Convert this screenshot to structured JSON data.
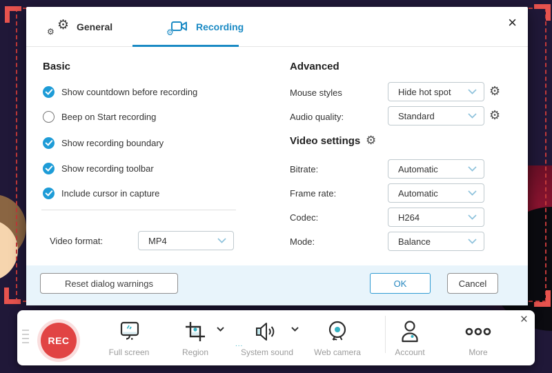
{
  "dialog": {
    "close_glyph": "×",
    "tabs": [
      {
        "label": "General",
        "active": false
      },
      {
        "label": "Recording",
        "active": true
      }
    ],
    "basic": {
      "heading": "Basic",
      "options": [
        {
          "label": "Show countdown before recording",
          "checked": true
        },
        {
          "label": "Beep on Start recording",
          "checked": false
        },
        {
          "label": "Show recording boundary",
          "checked": true
        },
        {
          "label": "Show recording toolbar",
          "checked": true
        },
        {
          "label": "Include cursor in capture",
          "checked": true
        }
      ],
      "video_format": {
        "label": "Video format:",
        "value": "MP4"
      }
    },
    "advanced": {
      "heading": "Advanced",
      "rows": [
        {
          "label": "Mouse styles",
          "value": "Hide hot spot"
        },
        {
          "label": "Audio quality:",
          "value": "Standard"
        }
      ],
      "video_settings_heading": "Video settings",
      "video_rows": [
        {
          "label": "Bitrate:",
          "value": "Automatic"
        },
        {
          "label": "Frame rate:",
          "value": "Automatic"
        },
        {
          "label": "Codec:",
          "value": "H264"
        },
        {
          "label": "Mode:",
          "value": "Balance"
        }
      ]
    },
    "footer": {
      "reset_label": "Reset dialog warnings",
      "ok_label": "OK",
      "cancel_label": "Cancel"
    }
  },
  "toolbar": {
    "rec_label": "REC",
    "close_glyph": "×",
    "dots_glyph": "...",
    "items": [
      {
        "label": "Full screen"
      },
      {
        "label": "Region"
      },
      {
        "label": "System sound"
      },
      {
        "label": "Web camera"
      },
      {
        "label": "Account"
      },
      {
        "label": "More"
      }
    ]
  },
  "colors": {
    "accent_blue": "#1a8ac4",
    "check_blue": "#1e9cd7",
    "rec_red": "#e14444",
    "teal": "#35b2c3",
    "boundary_red": "#e7534e",
    "footer_bg": "#e8f4fb"
  }
}
